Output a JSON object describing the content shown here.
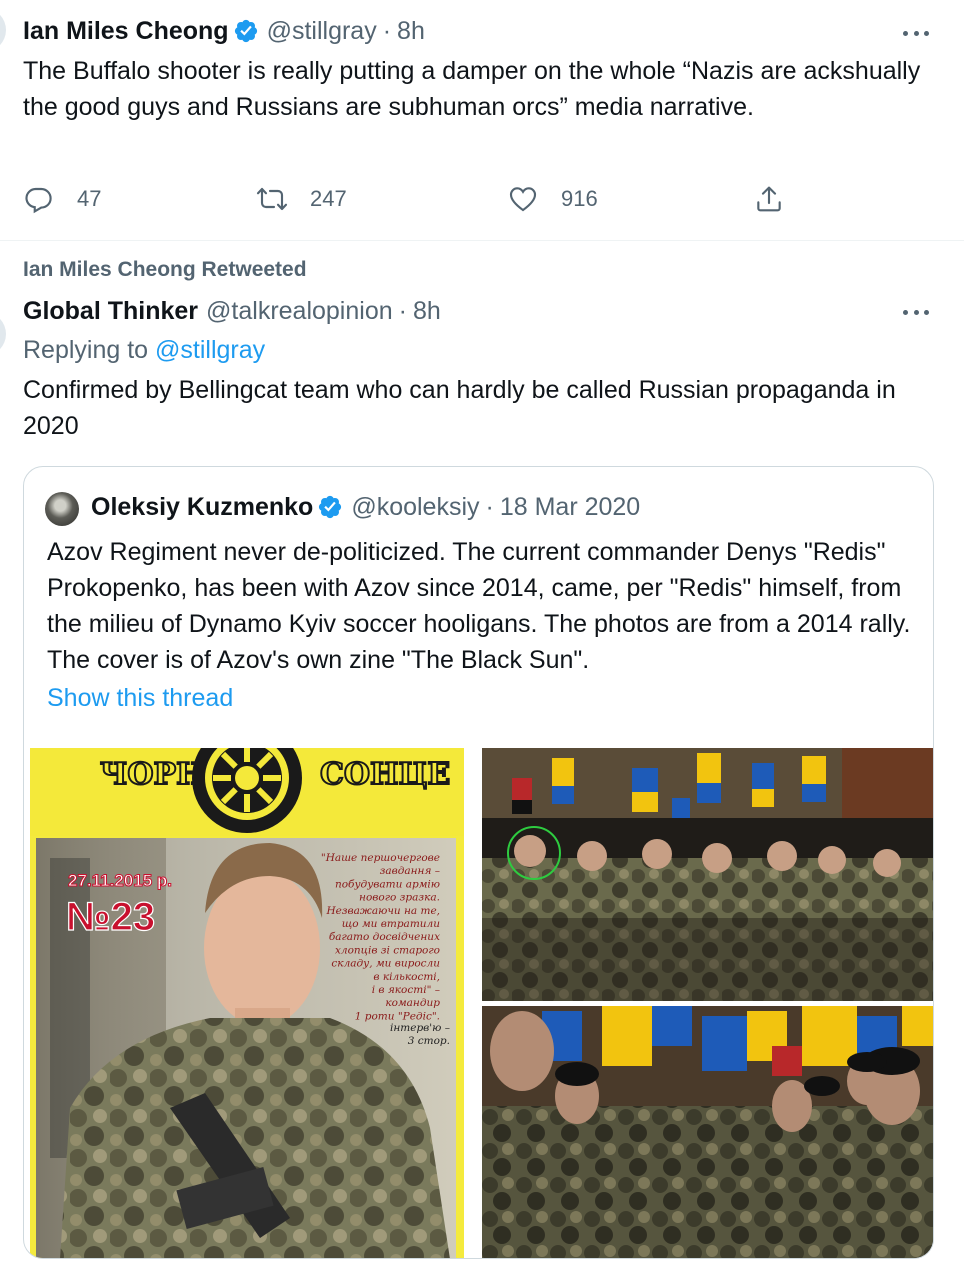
{
  "tweet1": {
    "author_name": "Ian Miles Cheong",
    "handle": "@stillgray",
    "separator": "·",
    "time": "8h",
    "text": "The Buffalo shooter is really putting a damper on the whole “Nazis are ackshually the good guys and Russians are subhuman orcs” media narrative.",
    "replies": "47",
    "retweets": "247",
    "likes": "916",
    "icons": [
      "verified-badge-icon",
      "more-icon",
      "reply-icon",
      "retweet-icon",
      "like-icon",
      "share-icon"
    ]
  },
  "tweet2": {
    "retweet_label": "Ian Miles Cheong Retweeted",
    "author_name": "Global Thinker",
    "handle": "@talkrealopinion",
    "separator": "·",
    "time": "8h",
    "replying_prefix": "Replying to",
    "replying_handle": "@stillgray",
    "text": "Confirmed by Bellingcat team who can hardly be called Russian propaganda in 2020"
  },
  "quote": {
    "author_name": "Oleksiy Kuzmenko",
    "handle": "@kooleksiy",
    "separator": "·",
    "date": "18 Mar 2020",
    "text": "Azov Regiment never de-politicized. The current commander Denys \"Redis\" Prokopenko, has been with Azov since 2014, came, per \"Redis\" himself, from the milieu of Dynamo Kyiv soccer hooligans. The photos are from a 2014 rally. The cover is of Azov's own zine \"The Black Sun\".",
    "show_thread": "Show this thread",
    "cover": {
      "title_left": "ЧОРНЕ",
      "title_right": "СОНЦЕ",
      "date": "27.11.2015 р.",
      "issue": "№23",
      "quote_lines": [
        "\"Наше першочергове",
        "завдання –",
        "побудувати армію",
        "нового зразка.",
        "Незважаючи на те,",
        "що ми втратили",
        "багато досвідчених",
        "хлопців зі старого",
        "складу, ми виросли",
        "в кількості,",
        "і в якості\" –",
        "командир",
        "1 роти \"Редіс\"."
      ],
      "interview_lines": [
        "інтерв'ю –",
        "3 стор."
      ]
    }
  },
  "colors": {
    "text": "#0f1419",
    "secondary": "#536471",
    "link": "#1d9bf0",
    "border": "#cfd9de",
    "verified": "#1d9bf0"
  }
}
